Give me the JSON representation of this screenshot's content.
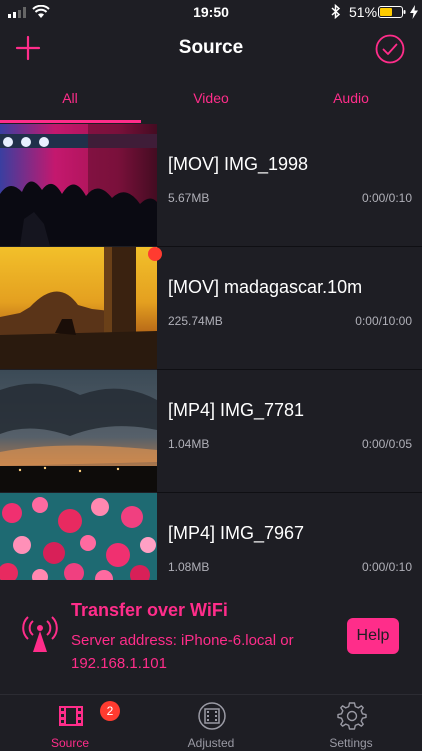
{
  "status_bar": {
    "time": "19:50",
    "battery": "51%"
  },
  "nav": {
    "title": "Source",
    "add_icon": "plus-icon",
    "done_icon": "check-circle-icon"
  },
  "tabs": [
    {
      "label": "All",
      "active": true
    },
    {
      "label": "Video",
      "active": false
    },
    {
      "label": "Audio",
      "active": false
    }
  ],
  "items": [
    {
      "title": "[MOV] IMG_1998",
      "size": "5.67MB",
      "duration": "0:00/0:10",
      "new": false
    },
    {
      "title": "[MOV] madagascar.10m",
      "size": "225.74MB",
      "duration": "0:00/10:00",
      "new": true
    },
    {
      "title": "[MP4] IMG_7781",
      "size": "1.04MB",
      "duration": "0:00/0:05",
      "new": false
    },
    {
      "title": "[MP4] IMG_7967",
      "size": "1.08MB",
      "duration": "0:00/0:10",
      "new": false
    }
  ],
  "transfer": {
    "title": "Transfer over WiFi",
    "line1": "Server address: iPhone-6.local or",
    "line2": "192.168.1.101",
    "help_label": "Help"
  },
  "tabbar": [
    {
      "label": "Source",
      "badge": "2",
      "icon": "film-icon",
      "active": true
    },
    {
      "label": "Adjusted",
      "icon": "adjusted-film-icon",
      "active": false
    },
    {
      "label": "Settings",
      "icon": "gear-icon",
      "active": false
    }
  ],
  "colors": {
    "accent": "#ff2d8a",
    "background": "#1e1e24",
    "badge": "#ff3b30"
  }
}
